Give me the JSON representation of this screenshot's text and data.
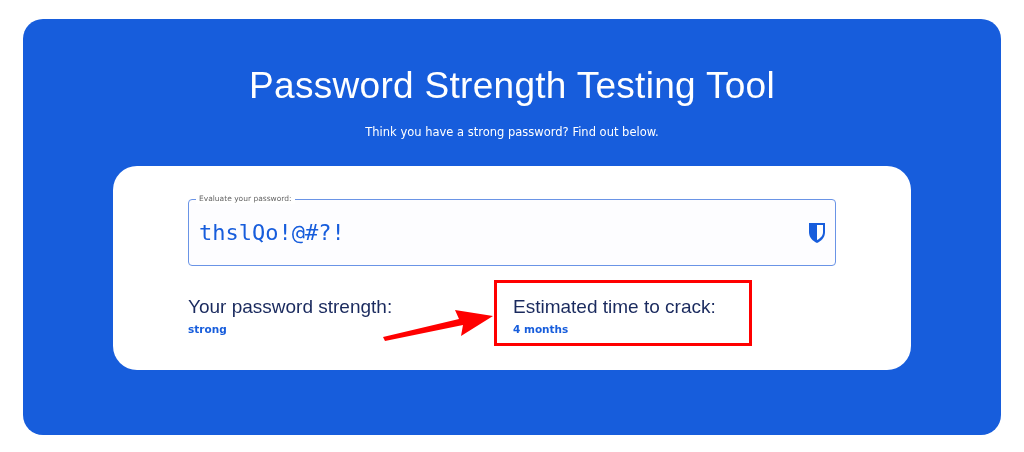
{
  "title": "Password Strength Testing Tool",
  "subtitle": "Think you have a strong password? Find out below.",
  "password_field": {
    "label": "Evaluate your password:",
    "value": "thslQo!@#?!"
  },
  "results": [
    {
      "label": "Your password strength:",
      "value": "strong",
      "highlighted": false
    },
    {
      "label": "Estimated time to crack:",
      "value": "4 months",
      "highlighted": true
    }
  ]
}
